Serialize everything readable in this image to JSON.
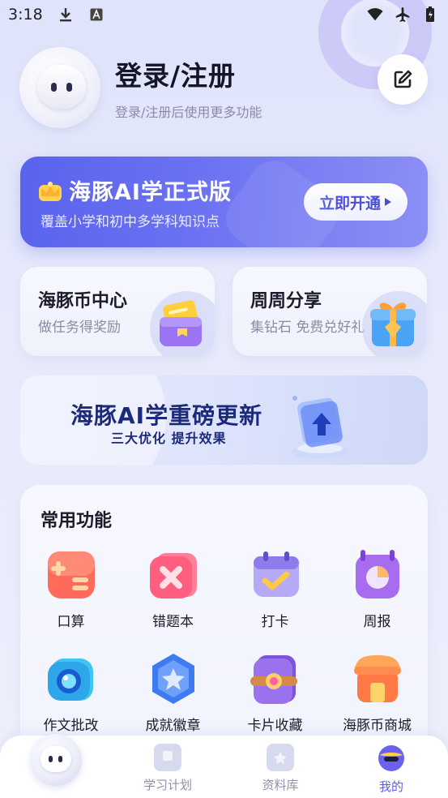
{
  "status_bar": {
    "time": "3:18"
  },
  "profile": {
    "title": "登录/注册",
    "subtitle": "登录/注册后使用更多功能"
  },
  "promo": {
    "title": "海豚AI学正式版",
    "subtitle": "覆盖小学和初中多学科知识点",
    "button": "立即开通"
  },
  "cards": [
    {
      "title": "海豚币中心",
      "subtitle": "做任务得奖励"
    },
    {
      "title": "周周分享",
      "subtitle": "集钻石 免费兑好礼"
    }
  ],
  "update_banner": {
    "title": "海豚AI学重磅更新",
    "subtitle": "三大优化 提升效果"
  },
  "common": {
    "title": "常用功能",
    "items": [
      {
        "label": "口算",
        "icon": "calculator-icon"
      },
      {
        "label": "错题本",
        "icon": "mistakes-book-icon"
      },
      {
        "label": "打卡",
        "icon": "calendar-check-icon"
      },
      {
        "label": "周报",
        "icon": "weekly-report-icon"
      },
      {
        "label": "作文批改",
        "icon": "camera-icon"
      },
      {
        "label": "成就徽章",
        "icon": "star-badge-icon"
      },
      {
        "label": "卡片收藏",
        "icon": "card-collection-icon"
      },
      {
        "label": "海豚币商城",
        "icon": "shop-icon"
      }
    ]
  },
  "bottom_nav": {
    "items": [
      {
        "label": "学习计划"
      },
      {
        "label": "资料库"
      },
      {
        "label": "我的"
      }
    ],
    "active_index": 2,
    "active_color": "#5a5ff0"
  }
}
